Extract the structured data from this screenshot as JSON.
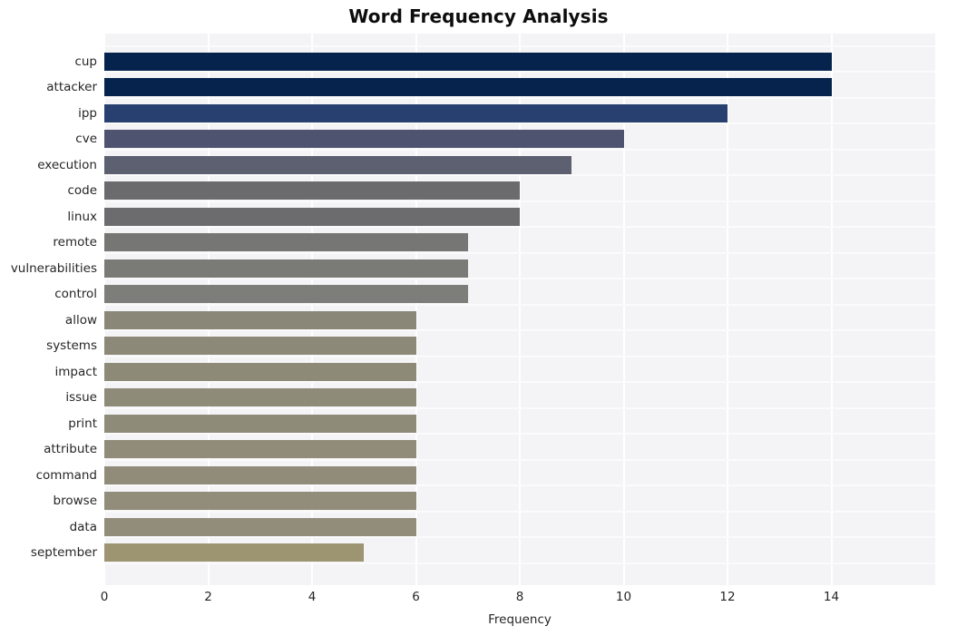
{
  "chart_data": {
    "type": "bar",
    "orientation": "horizontal",
    "title": "Word Frequency Analysis",
    "xlabel": "Frequency",
    "ylabel": "",
    "xlim": [
      0,
      16
    ],
    "xticks": [
      0,
      2,
      4,
      6,
      8,
      10,
      12,
      14
    ],
    "xticklabels": [
      "0",
      "2",
      "4",
      "6",
      "8",
      "10",
      "12",
      "14"
    ],
    "grid": true,
    "grid_axis": "both",
    "legend": null,
    "categories": [
      "cup",
      "attacker",
      "ipp",
      "cve",
      "execution",
      "code",
      "linux",
      "remote",
      "vulnerabilities",
      "control",
      "allow",
      "systems",
      "impact",
      "issue",
      "print",
      "attribute",
      "command",
      "browse",
      "data",
      "september"
    ],
    "values": [
      14,
      14,
      12,
      10,
      9,
      8,
      8,
      7,
      7,
      7,
      6,
      6,
      6,
      6,
      6,
      6,
      6,
      6,
      6,
      5
    ],
    "bar_colors": [
      "#06234d",
      "#06234d",
      "#27406f",
      "#4e5470",
      "#5c6070",
      "#6b6b6d",
      "#6c6c6e",
      "#767674",
      "#7a7a77",
      "#7d7d79",
      "#8b8778",
      "#8d8978",
      "#8e8a78",
      "#8f8b79",
      "#8f8b79",
      "#908c79",
      "#908c79",
      "#918d7a",
      "#918d7a",
      "#9d9471"
    ],
    "plot_background": "#f4f4f6",
    "figure_background": "#ffffff",
    "gridline_color": "#ffffff",
    "text_color": "#262626"
  }
}
